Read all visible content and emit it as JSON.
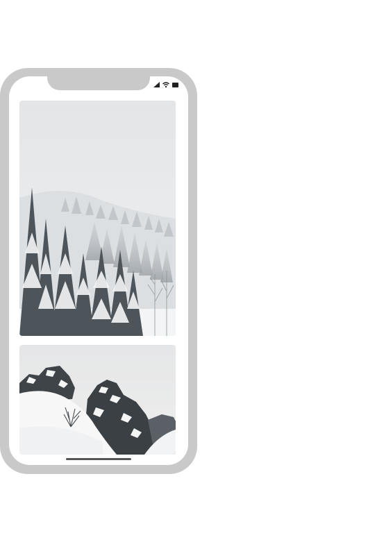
{
  "device": {
    "frame_color": "#c9c9c9",
    "screen_color": "#ffffff"
  },
  "status_bar": {
    "icons": [
      "cellular-signal-icon",
      "wifi-icon",
      "battery-icon"
    ]
  },
  "feed": {
    "images": [
      {
        "subject": "snow-covered-forest-photo"
      },
      {
        "subject": "snowy-rocky-outcrop-photo"
      }
    ]
  },
  "home_indicator": {
    "visible": true
  }
}
